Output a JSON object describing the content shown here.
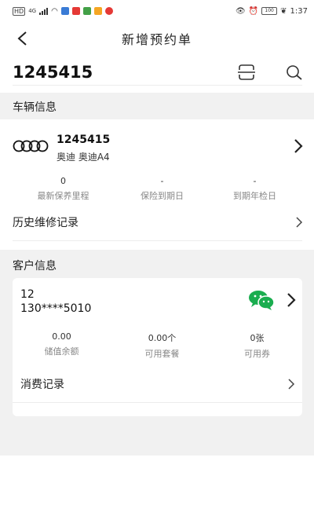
{
  "status_bar": {
    "network_badge": "HD",
    "network_type": "4G",
    "battery_text": "100",
    "time": "1:37",
    "colors": {
      "app1": "#3a7bd5",
      "app2": "#e53935",
      "app3": "#43a047",
      "app4": "#f5a623"
    }
  },
  "nav": {
    "title": "新增预约单",
    "back_icon": "chevron-left-icon"
  },
  "header": {
    "plate_number": "1245415",
    "scan_icon": "scan-icon",
    "search_icon": "search-icon"
  },
  "vehicle_section": {
    "title": "车辆信息",
    "plate": "1245415",
    "model": "奥迪 奥迪A4",
    "logo": "audi-rings-icon",
    "stats": [
      {
        "value": "0",
        "label": "最新保养里程"
      },
      {
        "value": "-",
        "label": "保险到期日"
      },
      {
        "value": "-",
        "label": "到期年检日"
      }
    ],
    "history_label": "历史维修记录"
  },
  "customer_section": {
    "title": "客户信息",
    "name": "12",
    "phone": "130****5010",
    "wechat_icon": "wechat-icon",
    "stats": [
      {
        "value": "0.00",
        "label": "储值余额"
      },
      {
        "value": "0.00个",
        "label": "可用套餐"
      },
      {
        "value": "0张",
        "label": "可用券"
      }
    ],
    "consumption_label": "消费记录"
  },
  "colors": {
    "page_bg": "#f1f1f1",
    "card_bg": "#ffffff",
    "wechat_green": "#1aad4f",
    "text_primary": "#222222",
    "text_secondary": "#888888"
  }
}
